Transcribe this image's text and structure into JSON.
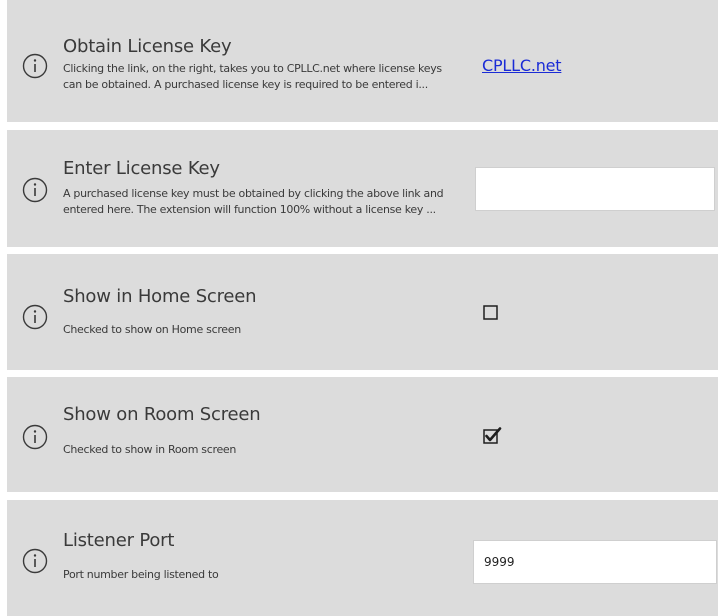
{
  "settings": [
    {
      "title": "Obtain License Key",
      "description_lines": [
        "Clicking the link, on the right, takes you to CPLLC.net where license keys",
        "can be obtained.  A purchased license key is required to be entered i..."
      ],
      "link_text": "CPLLC.net",
      "icon": "info-icon"
    },
    {
      "title": "Enter License Key",
      "description_lines": [
        "A purchased license key must be obtained by clicking the above link and",
        "entered here. The extension will function 100% without a license key ..."
      ],
      "input_value": "",
      "icon": "info-icon"
    },
    {
      "title": "Show in Home Screen",
      "description": "Checked to show on Home screen",
      "checked": false,
      "icon": "info-icon"
    },
    {
      "title": "Show on Room Screen",
      "description": "Checked to show in Room screen",
      "checked": true,
      "icon": "info-icon"
    },
    {
      "title": "Listener Port",
      "description": "Port number being listened to",
      "input_value": "9999",
      "icon": "info-icon"
    }
  ],
  "colors": {
    "row_background": "#dcdcdc",
    "text": "#3a3a3a",
    "link": "#1a2bd6"
  }
}
